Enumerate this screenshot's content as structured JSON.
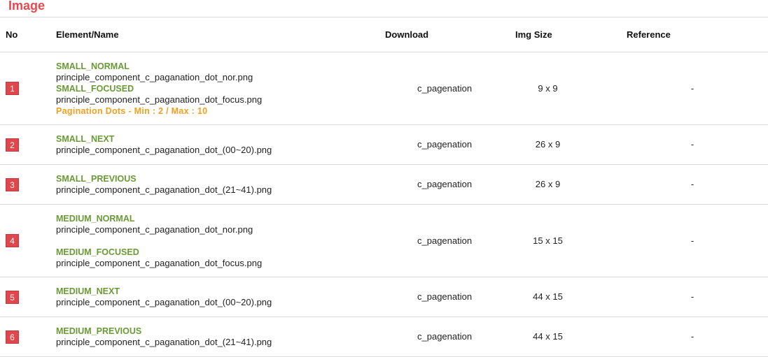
{
  "section_title": "Image",
  "columns": {
    "no": "No",
    "element": "Element/Name",
    "download": "Download",
    "img_size": "Img Size",
    "reference": "Reference"
  },
  "rows": [
    {
      "no": "1",
      "name_a": "SMALL_NORMAL",
      "file_a": "principle_component_c_paganation_dot_nor.png",
      "name_b": "SMALL_FOCUSED",
      "file_b": "principle_component_c_paganation_dot_focus.png",
      "note": "Pagination Dots - Min : 2 / Max  : 10",
      "download": "c_pagenation",
      "img_size": "9 x 9",
      "reference": "-"
    },
    {
      "no": "2",
      "name_a": "SMALL_NEXT",
      "file_a": "principle_component_c_paganation_dot_(00~20).png",
      "download": "c_pagenation",
      "img_size": "26 x 9",
      "reference": "-"
    },
    {
      "no": "3",
      "name_a": "SMALL_PREVIOUS",
      "file_a": "principle_component_c_paganation_dot_(21~41).png",
      "download": "c_pagenation",
      "img_size": "26 x 9",
      "reference": "-"
    },
    {
      "no": "4",
      "name_a": "MEDIUM_NORMAL",
      "file_a": "principle_component_c_paganation_dot_nor.png",
      "name_b": "MEDIUM_FOCUSED",
      "file_b": "principle_component_c_paganation_dot_focus.png",
      "download": "c_pagenation",
      "img_size": "15 x 15",
      "reference": "-"
    },
    {
      "no": "5",
      "name_a": "MEDIUM_NEXT",
      "file_a": "principle_component_c_paganation_dot_(00~20).png",
      "download": "c_pagenation",
      "img_size": "44 x 15",
      "reference": "-"
    },
    {
      "no": "6",
      "name_a": "MEDIUM_PREVIOUS",
      "file_a": "principle_component_c_paganation_dot_(21~41).png",
      "download": "c_pagenation",
      "img_size": "44 x 15",
      "reference": "-"
    }
  ]
}
